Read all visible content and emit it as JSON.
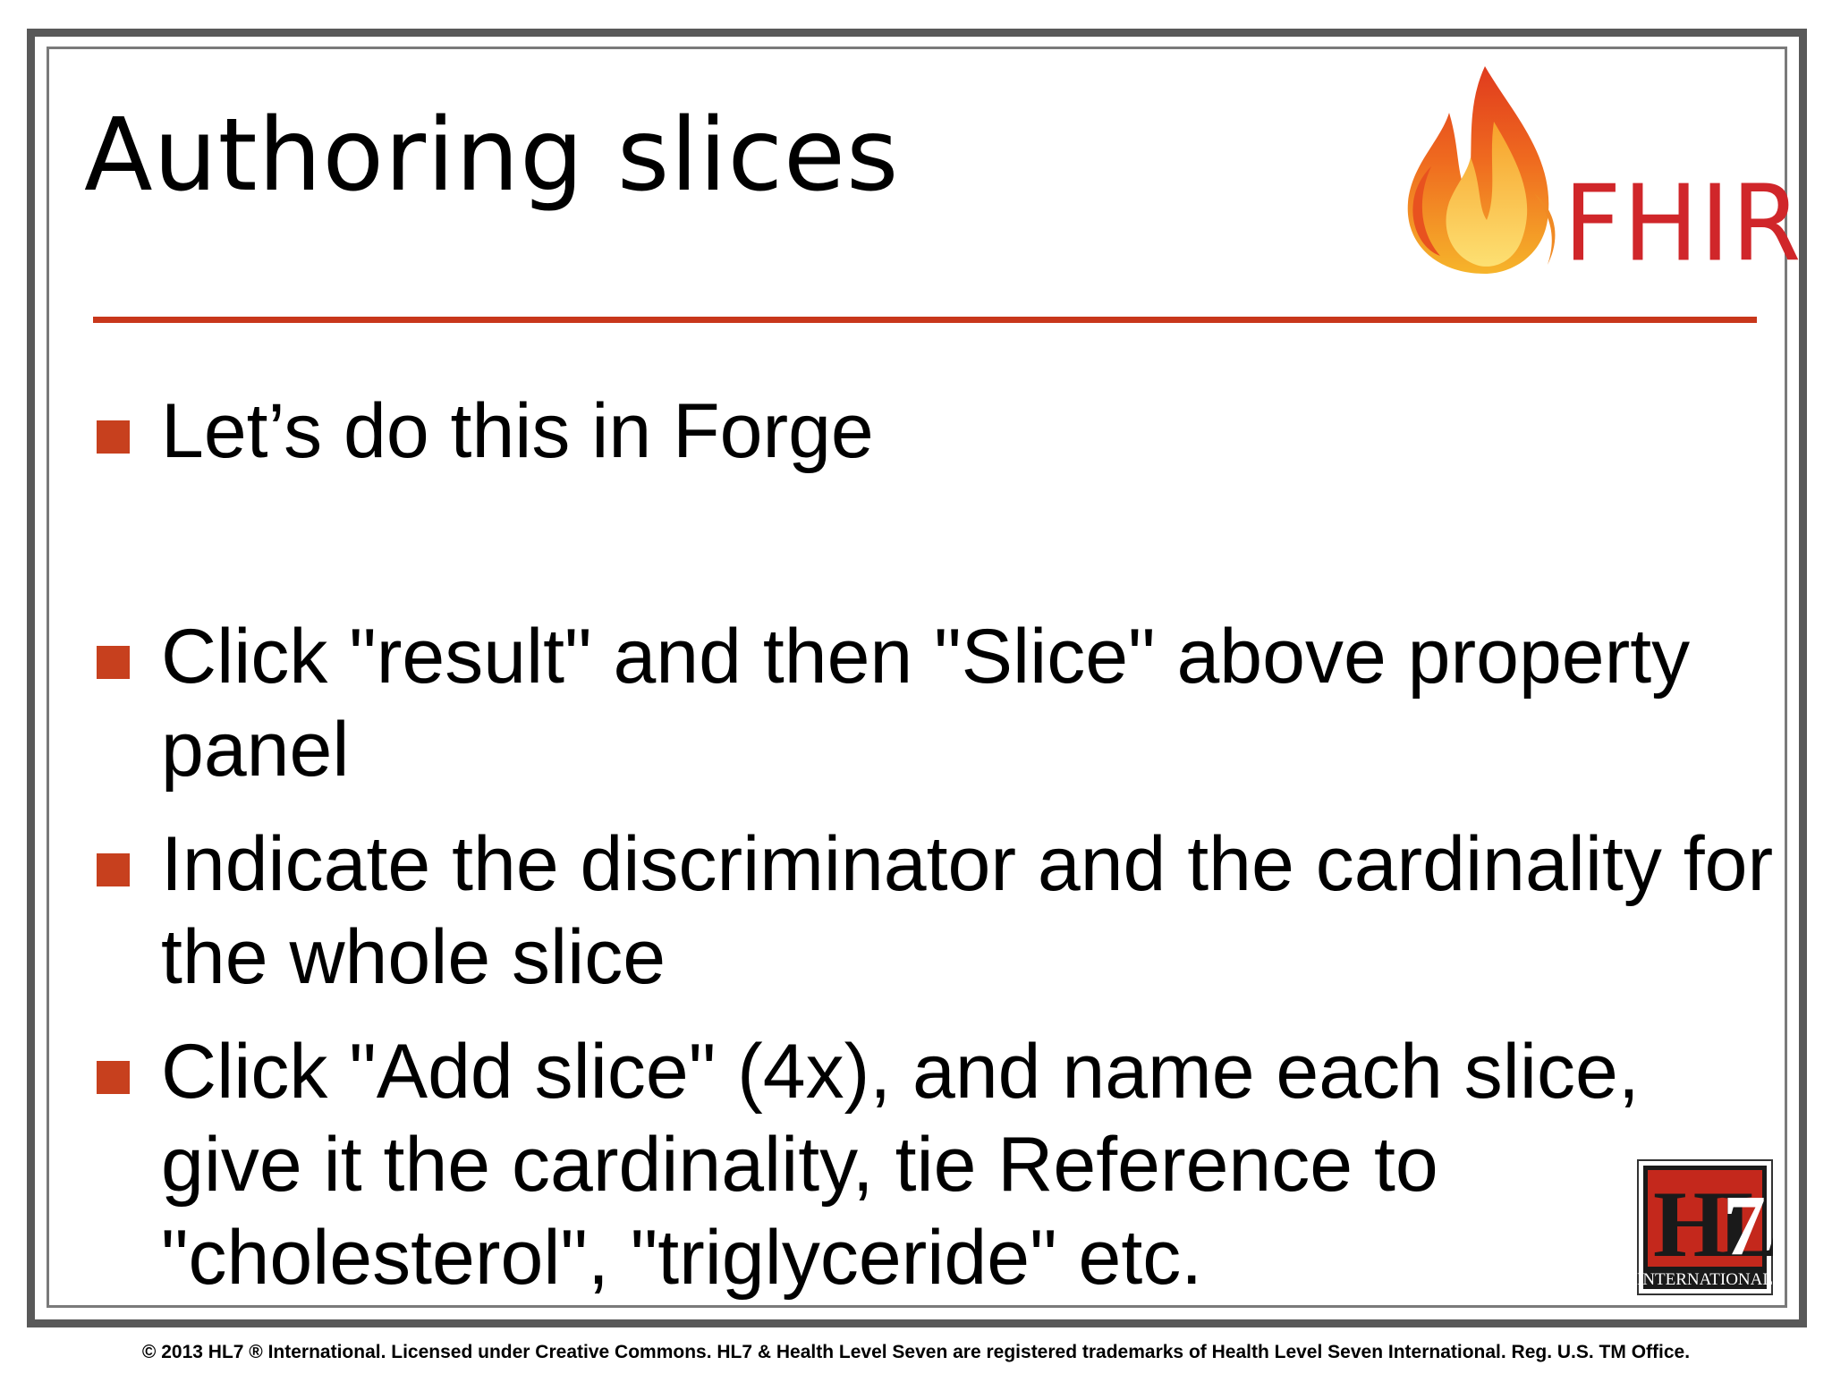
{
  "slide": {
    "title": "Authoring slices",
    "logo_text": "FHIR",
    "bullets": [
      "Let’s do this in Forge",
      "Click \"result\" and then \"Slice\" above property panel",
      "Indicate the discriminator and the cardinality for the whole slice",
      "Click \"Add slice\" (4x), and name each slice, give it the cardinality, tie Reference to \"cholesterol\", \"triglyceride\" etc."
    ],
    "hl7_logo_text": "HL7",
    "hl7_logo_subtext": "INTERNATIONAL"
  },
  "footer": {
    "copyright": "© 2013 HL7 ® International. Licensed under Creative Commons. HL7 & Health Level Seven are registered trademarks of Health Level Seven International. Reg. U.S. TM Office."
  },
  "colors": {
    "accent": "#c8371b",
    "fhir_red": "#d0262a",
    "frame": "#595959"
  }
}
